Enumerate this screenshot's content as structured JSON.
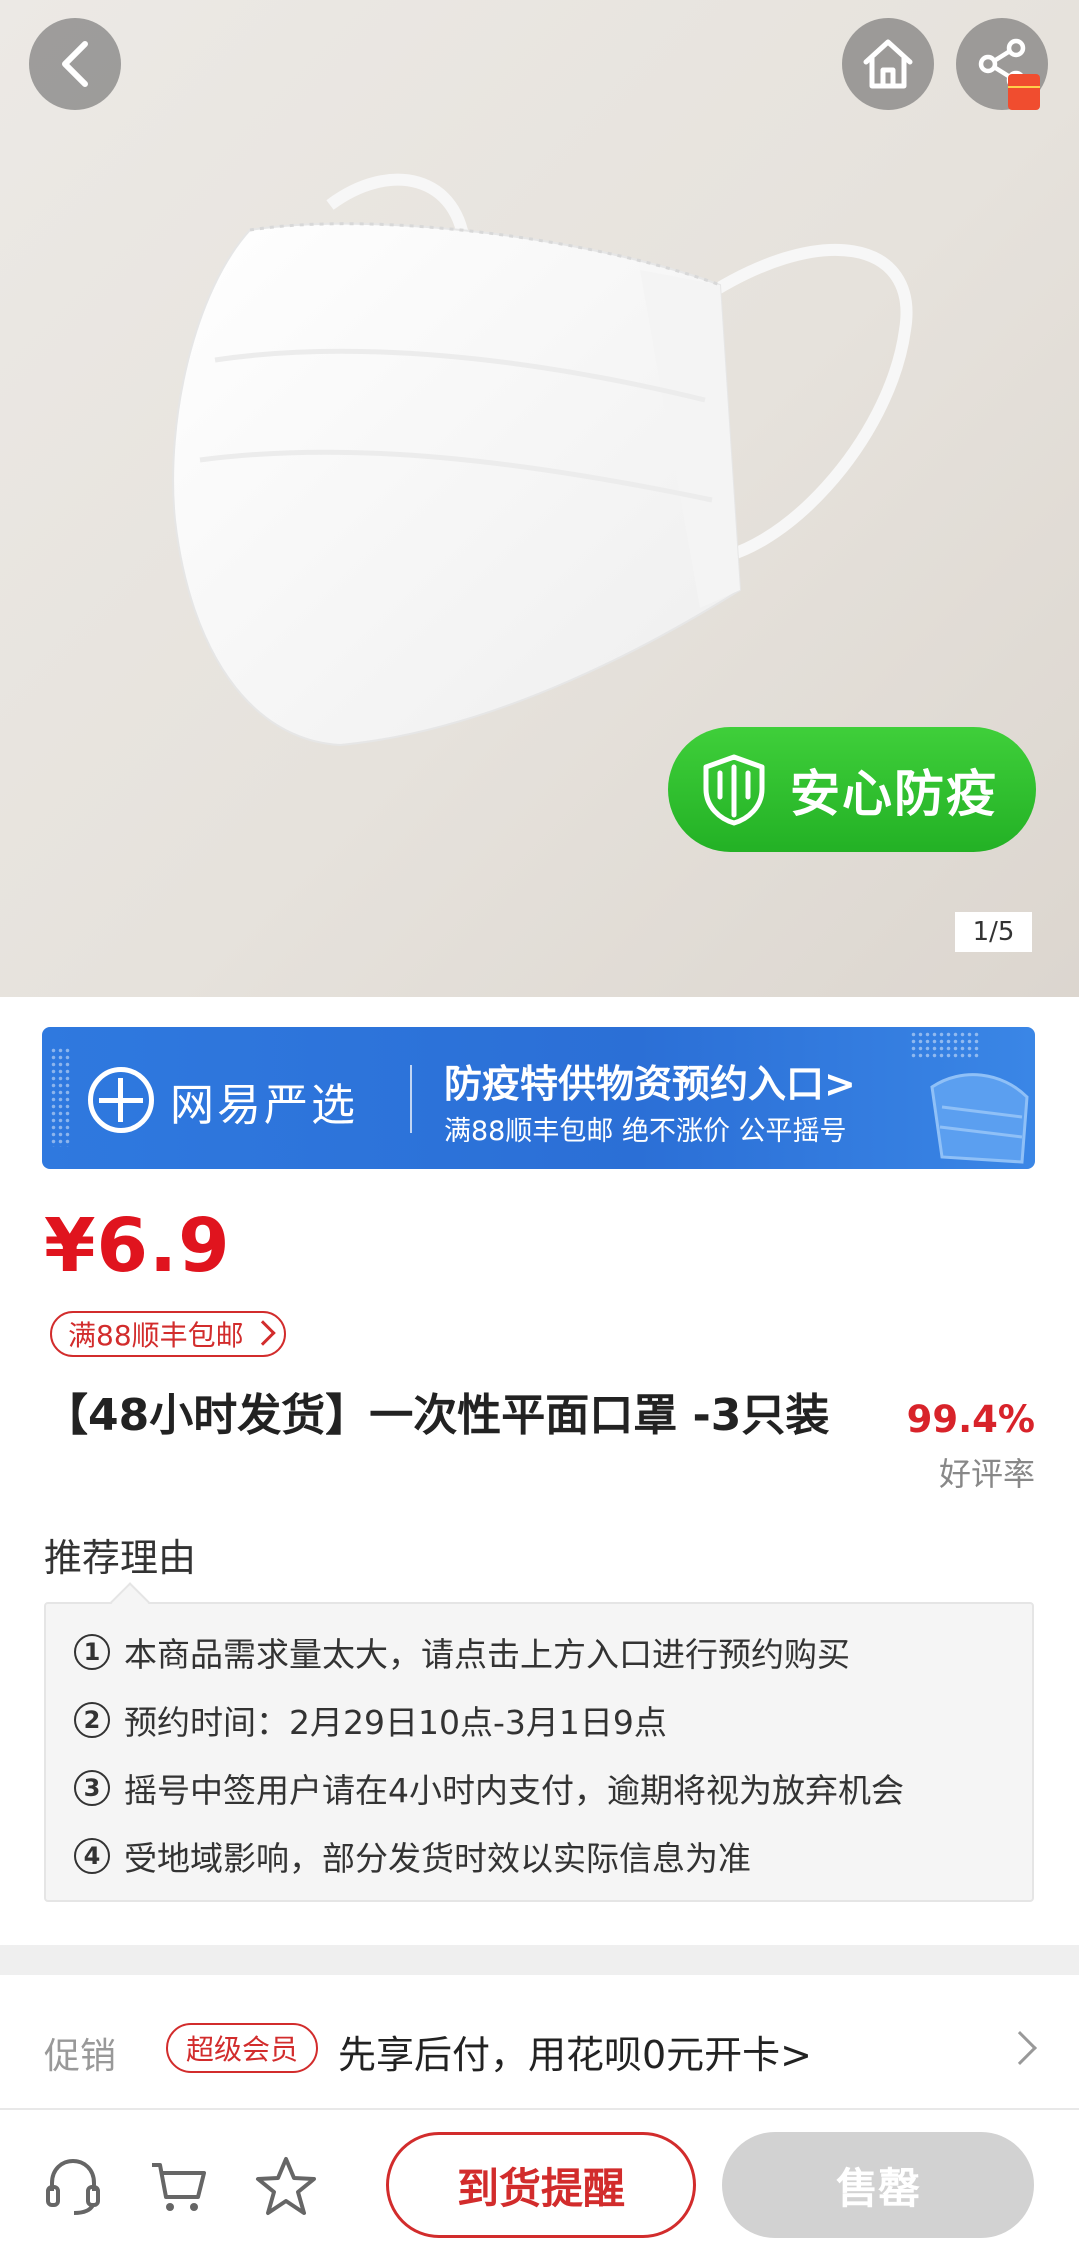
{
  "gallery": {
    "badge_text": "安心防疫",
    "pager": "1/5"
  },
  "banner": {
    "brand": "网易严选",
    "title": "防疫特供物资预约入口>",
    "subtitle": "满88顺丰包邮  绝不涨价  公平摇号"
  },
  "product": {
    "price": "¥6.9",
    "shipping_tag": "满88顺丰包邮",
    "title": "【48小时发货】一次性平面口罩 -3只装",
    "rating_percent": "99.4%",
    "rating_label": "好评率"
  },
  "reasons": {
    "title": "推荐理由",
    "items": [
      {
        "num": "1",
        "text": "本商品需求量太大，请点击上方入口进行预约购买"
      },
      {
        "num": "2",
        "text": "预约时间：2月29日10点-3月1日9点"
      },
      {
        "num": "3",
        "text": "摇号中签用户请在4小时内支付，逾期将视为放弃机会"
      },
      {
        "num": "4",
        "text": "受地域影响，部分发货时效以实际信息为准"
      }
    ]
  },
  "promo": {
    "label": "促销",
    "tag": "超级会员",
    "text": "先享后付，用花呗0元开卡>"
  },
  "bottom_bar": {
    "icons": [
      "headset-icon",
      "cart-icon",
      "star-icon"
    ],
    "remind_label": "到货提醒",
    "soldout_label": "售罄"
  },
  "colors": {
    "price_red": "#e0141e",
    "accent_red": "#d22c2c",
    "banner_blue": "#2f79df",
    "badge_green": "#2bbb2c",
    "soldout_gray": "#d2d2d2"
  }
}
